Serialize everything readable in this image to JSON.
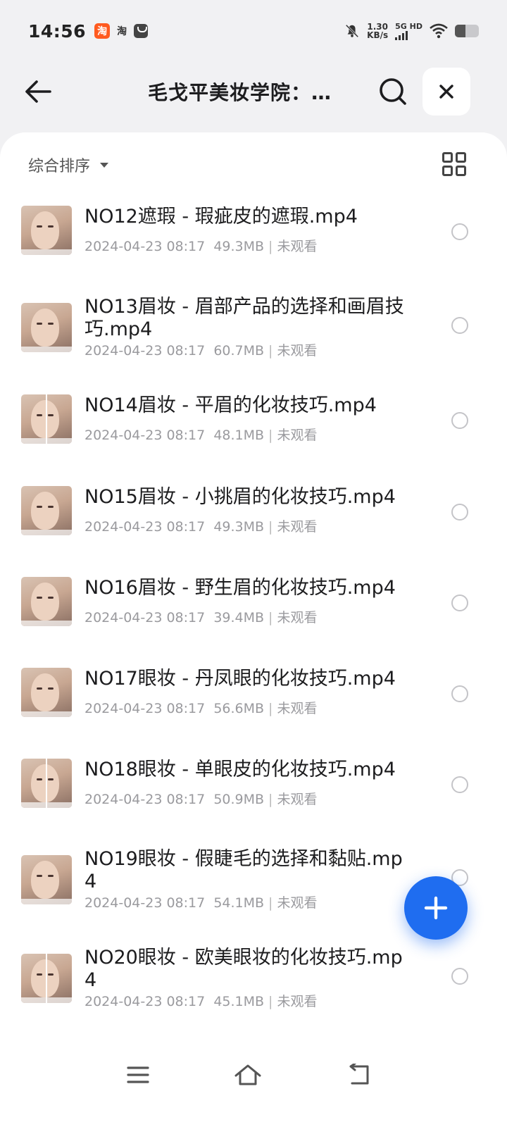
{
  "status_bar": {
    "time": "14:56",
    "app_icon_label": "淘",
    "app_text": "淘",
    "speed_value": "1.30",
    "speed_unit": "KB/s",
    "network": "5G HD"
  },
  "header": {
    "title": "毛戈平美妆学院：…"
  },
  "toolbar": {
    "sort_label": "综合排序"
  },
  "files": [
    {
      "name": "NO12遮瑕 - 瑕疵皮的遮瑕.mp4",
      "date": "2024-04-23 08:17",
      "size": "49.3MB",
      "status": "未观看"
    },
    {
      "name": "NO13眉妆 - 眉部产品的选择和画眉技巧.mp4",
      "date": "2024-04-23 08:17",
      "size": "60.7MB",
      "status": "未观看"
    },
    {
      "name": "NO14眉妆 - 平眉的化妆技巧.mp4",
      "date": "2024-04-23 08:17",
      "size": "48.1MB",
      "status": "未观看"
    },
    {
      "name": "NO15眉妆 - 小挑眉的化妆技巧.mp4",
      "date": "2024-04-23 08:17",
      "size": "49.3MB",
      "status": "未观看"
    },
    {
      "name": "NO16眉妆 - 野生眉的化妆技巧.mp4",
      "date": "2024-04-23 08:17",
      "size": "39.4MB",
      "status": "未观看"
    },
    {
      "name": "NO17眼妆 - 丹凤眼的化妆技巧.mp4",
      "date": "2024-04-23 08:17",
      "size": "56.6MB",
      "status": "未观看"
    },
    {
      "name": "NO18眼妆 - 单眼皮的化妆技巧.mp4",
      "date": "2024-04-23 08:17",
      "size": "50.9MB",
      "status": "未观看"
    },
    {
      "name": "NO19眼妆 - 假睫毛的选择和黏贴.mp4",
      "date": "2024-04-23 08:17",
      "size": "54.1MB",
      "status": "未观看"
    },
    {
      "name": "NO20眼妆 - 欧美眼妆的化妆技巧.mp4",
      "date": "2024-04-23 08:17",
      "size": "45.1MB",
      "status": "未观看"
    }
  ],
  "colors": {
    "accent": "#1f6df0",
    "background": "#f1f1f3",
    "meta_text": "#9a9a9e"
  },
  "icons": {
    "back": "arrow-left-icon",
    "search": "search-icon",
    "close": "close-icon",
    "grid": "grid-view-icon",
    "add": "plus-icon",
    "nav_menu": "menu-icon",
    "nav_home": "home-icon",
    "nav_back": "nav-back-icon"
  }
}
